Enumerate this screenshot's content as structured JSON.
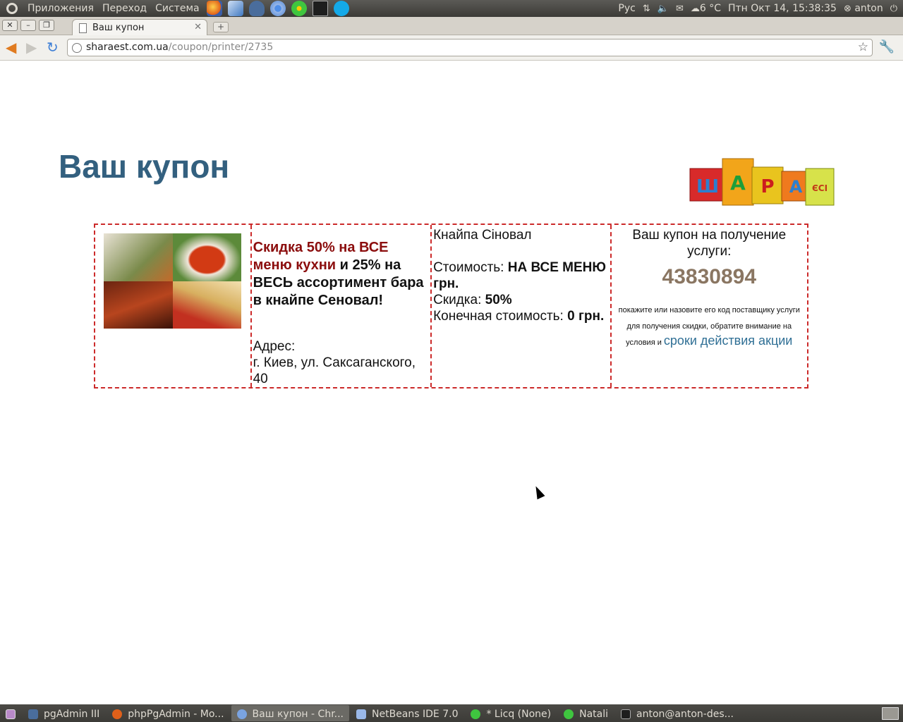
{
  "top_panel": {
    "menus": [
      "Приложения",
      "Переход",
      "Система"
    ],
    "launchers": [
      "firefox-icon",
      "virtualbox-icon",
      "pgadmin-icon",
      "chromium-icon",
      "icq-icon",
      "terminal-icon",
      "skype-icon"
    ],
    "keyboard_layout": "Рус",
    "weather": "6 °C",
    "clock": "Птн Окт 14, 15:38:35",
    "user": "anton"
  },
  "browser": {
    "tab_title": "Ваш купон",
    "url_host": "sharaest.com.ua",
    "url_path": "/coupon/printer/2735"
  },
  "page": {
    "title": "Ваш купон",
    "offer_red": "Скидка 50% на ВСЕ меню кухни",
    "offer_dark": " и  25% на ВЕСЬ ассортимент бара в кнайпе Сеновал!",
    "address_label": "Адрес:",
    "address_value": "г. Киев, ул. Саксаганского, 40",
    "venue": "Кнайпа Сiновал",
    "price_label": "Стоимость: ",
    "price_value": "НА ВСЕ МЕНЮ грн.",
    "discount_label": "Скидка: ",
    "discount_value": "50%",
    "final_label": "Конечная стоимость: ",
    "final_value": "0 грн.",
    "coupon_heading": "Ваш купон на получение услуги:",
    "coupon_code": "43830894",
    "note": "покажите или назовите его код поставщику услуги для получения скидки, обратите внимание на условия и ",
    "terms_link": "сроки действия акции",
    "logo_letters": [
      "Ш",
      "А",
      "Р",
      "А",
      "ЄСІ"
    ]
  },
  "taskbar": {
    "items": [
      {
        "label": "pgAdmin III",
        "active": false
      },
      {
        "label": "phpPgAdmin - Mo...",
        "active": false
      },
      {
        "label": "Ваш купон - Chr...",
        "active": true
      },
      {
        "label": "NetBeans IDE 7.0",
        "active": false
      },
      {
        "label": "* Licq (None)",
        "active": false
      },
      {
        "label": "Natali",
        "active": false
      },
      {
        "label": "anton@anton-des...",
        "active": false
      }
    ]
  }
}
